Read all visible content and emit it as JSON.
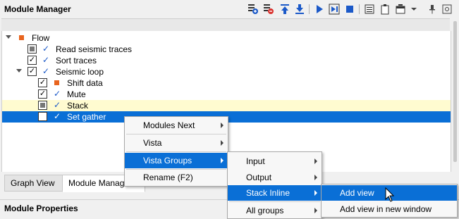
{
  "window": {
    "title": "Module Manager"
  },
  "toolbar": {
    "icons": [
      "add-module-icon",
      "remove-module-icon",
      "move-up-icon",
      "move-down-icon",
      "run-icon",
      "run-step-icon",
      "stop-icon",
      "list-icon",
      "clipboard-icon",
      "window-layout-icon",
      "dropdown-icon",
      "pin-icon",
      "settings-icon"
    ],
    "colors": {
      "blue": "#1b59c8",
      "red": "#d9302c",
      "orange": "#e8641e"
    }
  },
  "tree": {
    "items": [
      {
        "label": "Flow",
        "marker": "orange-square",
        "expanded": true
      },
      {
        "label": "Read seismic traces",
        "checkbox": "partial",
        "checked_icon": "tick"
      },
      {
        "label": "Sort traces",
        "checkbox": "checked",
        "checked_icon": "tick"
      },
      {
        "label": "Seismic loop",
        "checkbox": "checked",
        "checked_icon": "tick",
        "expanded": true
      },
      {
        "label": "Shift data",
        "checkbox": "checked",
        "marker": "orange-square"
      },
      {
        "label": "Mute",
        "checkbox": "checked",
        "checked_icon": "tick"
      },
      {
        "label": "Stack",
        "checkbox": "partial",
        "checked_icon": "tick",
        "highlight": "yellow"
      },
      {
        "label": "Set gather",
        "checkbox": "checked",
        "checked_icon": "tick",
        "highlight": "selected"
      }
    ],
    "check_mark": "✓"
  },
  "tabs": [
    {
      "label": "Graph View",
      "active": false
    },
    {
      "label": "Module Manager",
      "active": true
    }
  ],
  "properties": {
    "title": "Module Properties"
  },
  "context_menu": {
    "items": [
      {
        "label": "Modules Next",
        "submenu": true
      },
      {
        "label": "Vista",
        "submenu": true
      },
      {
        "label": "Vista Groups",
        "submenu": true,
        "selected": true
      },
      {
        "label": "Rename (F2)",
        "submenu": false
      }
    ]
  },
  "vista_groups_menu": {
    "items": [
      {
        "label": "Input",
        "submenu": true
      },
      {
        "label": "Output",
        "submenu": true
      },
      {
        "label": "Stack Inline",
        "submenu": true,
        "selected": true
      },
      {
        "label": "All groups",
        "submenu": true
      }
    ]
  },
  "stack_inline_menu": {
    "items": [
      {
        "label": "Add view",
        "selected": true
      },
      {
        "label": "Add view in new window",
        "selected": false
      }
    ]
  },
  "accent_color": "#0a6fd6"
}
